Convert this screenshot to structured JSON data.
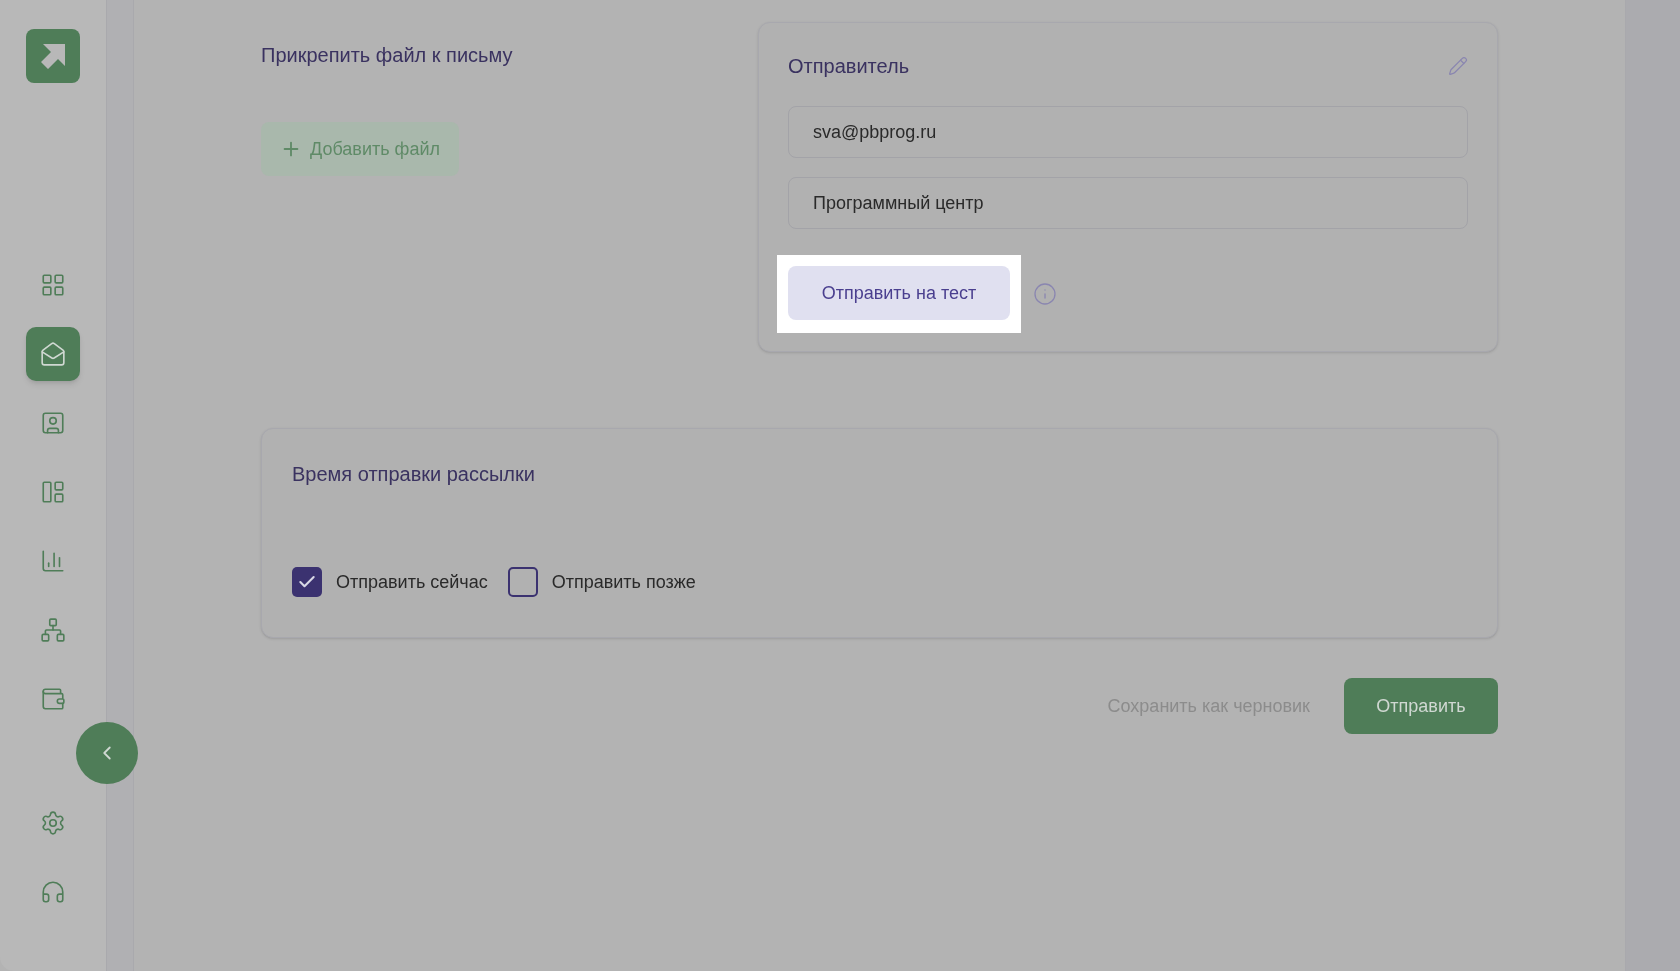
{
  "sidebar": {
    "items": [
      {
        "kind": "grid",
        "selected": false
      },
      {
        "kind": "mail",
        "selected": true
      },
      {
        "kind": "contacts",
        "selected": false
      },
      {
        "kind": "templates",
        "selected": false
      },
      {
        "kind": "stats",
        "selected": false
      },
      {
        "kind": "structure",
        "selected": false
      },
      {
        "kind": "wallet",
        "selected": false
      }
    ],
    "bottom_items": [
      {
        "kind": "settings",
        "selected": false
      },
      {
        "kind": "support",
        "selected": false
      }
    ]
  },
  "attachment": {
    "title": "Прикрепить файл к письму",
    "add_button": "Добавить файл"
  },
  "sender": {
    "title": "Отправитель",
    "email": "sva@pbprog.ru",
    "name": "Программный центр",
    "test_button": "Отправить на тест"
  },
  "schedule": {
    "title": "Время отправки рассылки",
    "options": [
      {
        "label": "Отправить сейчас",
        "checked": true
      },
      {
        "label": "Отправить позже",
        "checked": false
      }
    ]
  },
  "actions": {
    "draft": "Сохранить как черновик",
    "send": "Отправить"
  }
}
